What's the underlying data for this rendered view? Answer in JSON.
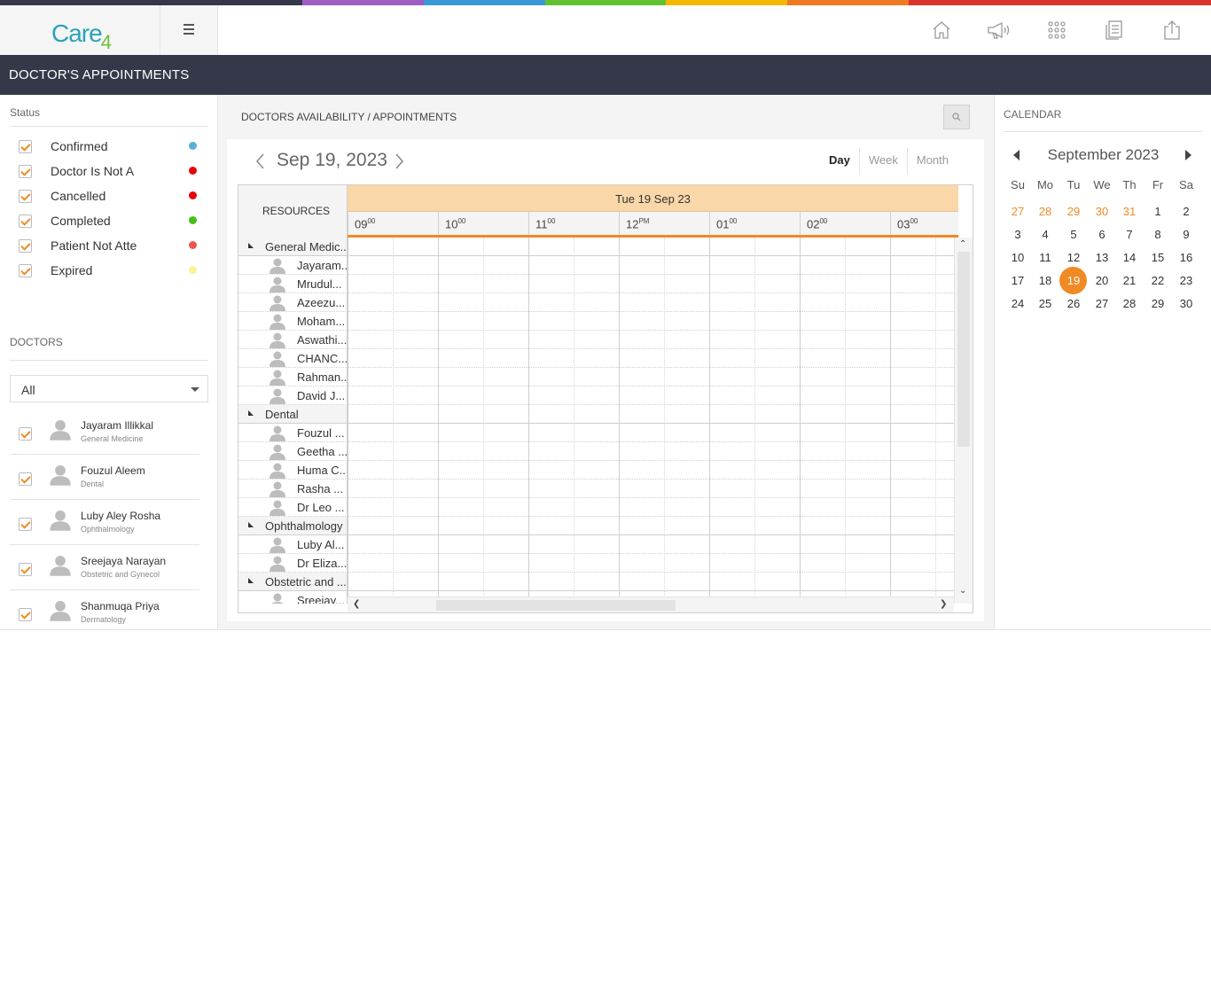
{
  "brand": {
    "logo_text": "Care",
    "logo_num": "4"
  },
  "header": {
    "title": "DOCTOR'S APPOINTMENTS"
  },
  "top_icons": [
    "home-icon",
    "megaphone-icon",
    "apps-grid-icon",
    "report-icon",
    "upload-icon"
  ],
  "colors": {
    "rainbow": [
      "#343849",
      "#a15cc3",
      "#3a9ad9",
      "#61c130",
      "#f5b800",
      "#ee7a24",
      "#d9342b"
    ],
    "accent": "#f08a24",
    "titlebar": "#343849",
    "day_header": "#f9d7a9"
  },
  "sidebar": {
    "status_label": "Status",
    "statuses": [
      {
        "label": "Confirmed",
        "color": "#5aafd6",
        "checked": true
      },
      {
        "label": "Doctor Is Not A",
        "color": "#e8000b",
        "checked": true
      },
      {
        "label": "Cancelled",
        "color": "#e8000b",
        "checked": true
      },
      {
        "label": "Completed",
        "color": "#46c015",
        "checked": true
      },
      {
        "label": "Patient Not Atte",
        "color": "#ef5350",
        "checked": true
      },
      {
        "label": "Expired",
        "color": "#fbf199",
        "checked": true
      }
    ],
    "doctors_label": "DOCTORS",
    "doctor_filter": "All",
    "doctors": [
      {
        "name": "Jayaram Illikkal",
        "dept": "General Medicine",
        "checked": true
      },
      {
        "name": "Fouzul Aleem",
        "dept": "Dental",
        "checked": true
      },
      {
        "name": "Luby Aley Rosha",
        "dept": "Ophthalmology",
        "checked": true
      },
      {
        "name": "Sreejaya Narayan",
        "dept": "Obstetric and Gynecol",
        "checked": true
      },
      {
        "name": "Shanmuqa Priya",
        "dept": "Dermatology",
        "checked": true
      }
    ]
  },
  "center": {
    "breadcrumb": "DOCTORS AVAILABILITY / APPOINTMENTS",
    "date_title": "Sep 19, 2023",
    "views": [
      "Day",
      "Week",
      "Month"
    ],
    "active_view": "Day",
    "resources_label": "RESOURCES",
    "day_header": "Tue 19 Sep 23",
    "hours": [
      {
        "h": "09",
        "s": "00"
      },
      {
        "h": "10",
        "s": "00"
      },
      {
        "h": "11",
        "s": "00"
      },
      {
        "h": "12",
        "s": "PM"
      },
      {
        "h": "01",
        "s": "00"
      },
      {
        "h": "02",
        "s": "00"
      },
      {
        "h": "03",
        "s": "00"
      }
    ],
    "rows": [
      {
        "type": "group",
        "label": "General Medic..."
      },
      {
        "type": "item",
        "label": "Jayaram..."
      },
      {
        "type": "item",
        "label": "Mrudul..."
      },
      {
        "type": "item",
        "label": "Azeezu..."
      },
      {
        "type": "item",
        "label": "Moham..."
      },
      {
        "type": "item",
        "label": "Aswathi..."
      },
      {
        "type": "item",
        "label": "CHANC..."
      },
      {
        "type": "item",
        "label": "Rahman..."
      },
      {
        "type": "item",
        "label": "David J..."
      },
      {
        "type": "group",
        "label": "Dental"
      },
      {
        "type": "item",
        "label": "Fouzul ..."
      },
      {
        "type": "item",
        "label": "Geetha ..."
      },
      {
        "type": "item",
        "label": "Huma C..."
      },
      {
        "type": "item",
        "label": "Rasha ..."
      },
      {
        "type": "item",
        "label": "Dr Leo ..."
      },
      {
        "type": "group",
        "label": "Ophthalmology"
      },
      {
        "type": "item",
        "label": "Luby Al..."
      },
      {
        "type": "item",
        "label": "Dr Eliza..."
      },
      {
        "type": "group",
        "label": "Obstetric and ..."
      },
      {
        "type": "item",
        "label": "Sreejay..."
      },
      {
        "type": "item",
        "label": ""
      }
    ]
  },
  "calendar": {
    "label": "CALENDAR",
    "month": "September 2023",
    "dow": [
      "Su",
      "Mo",
      "Tu",
      "We",
      "Th",
      "Fr",
      "Sa"
    ],
    "weeks": [
      [
        {
          "d": "27",
          "o": true
        },
        {
          "d": "28",
          "o": true
        },
        {
          "d": "29",
          "o": true
        },
        {
          "d": "30",
          "o": true
        },
        {
          "d": "31",
          "o": true
        },
        {
          "d": "1"
        },
        {
          "d": "2"
        }
      ],
      [
        {
          "d": "3"
        },
        {
          "d": "4"
        },
        {
          "d": "5"
        },
        {
          "d": "6"
        },
        {
          "d": "7"
        },
        {
          "d": "8"
        },
        {
          "d": "9"
        }
      ],
      [
        {
          "d": "10"
        },
        {
          "d": "11"
        },
        {
          "d": "12"
        },
        {
          "d": "13"
        },
        {
          "d": "14"
        },
        {
          "d": "15"
        },
        {
          "d": "16"
        }
      ],
      [
        {
          "d": "17"
        },
        {
          "d": "18"
        },
        {
          "d": "19",
          "sel": true
        },
        {
          "d": "20"
        },
        {
          "d": "21"
        },
        {
          "d": "22"
        },
        {
          "d": "23"
        }
      ],
      [
        {
          "d": "24"
        },
        {
          "d": "25"
        },
        {
          "d": "26"
        },
        {
          "d": "27"
        },
        {
          "d": "28"
        },
        {
          "d": "29"
        },
        {
          "d": "30"
        }
      ]
    ]
  }
}
